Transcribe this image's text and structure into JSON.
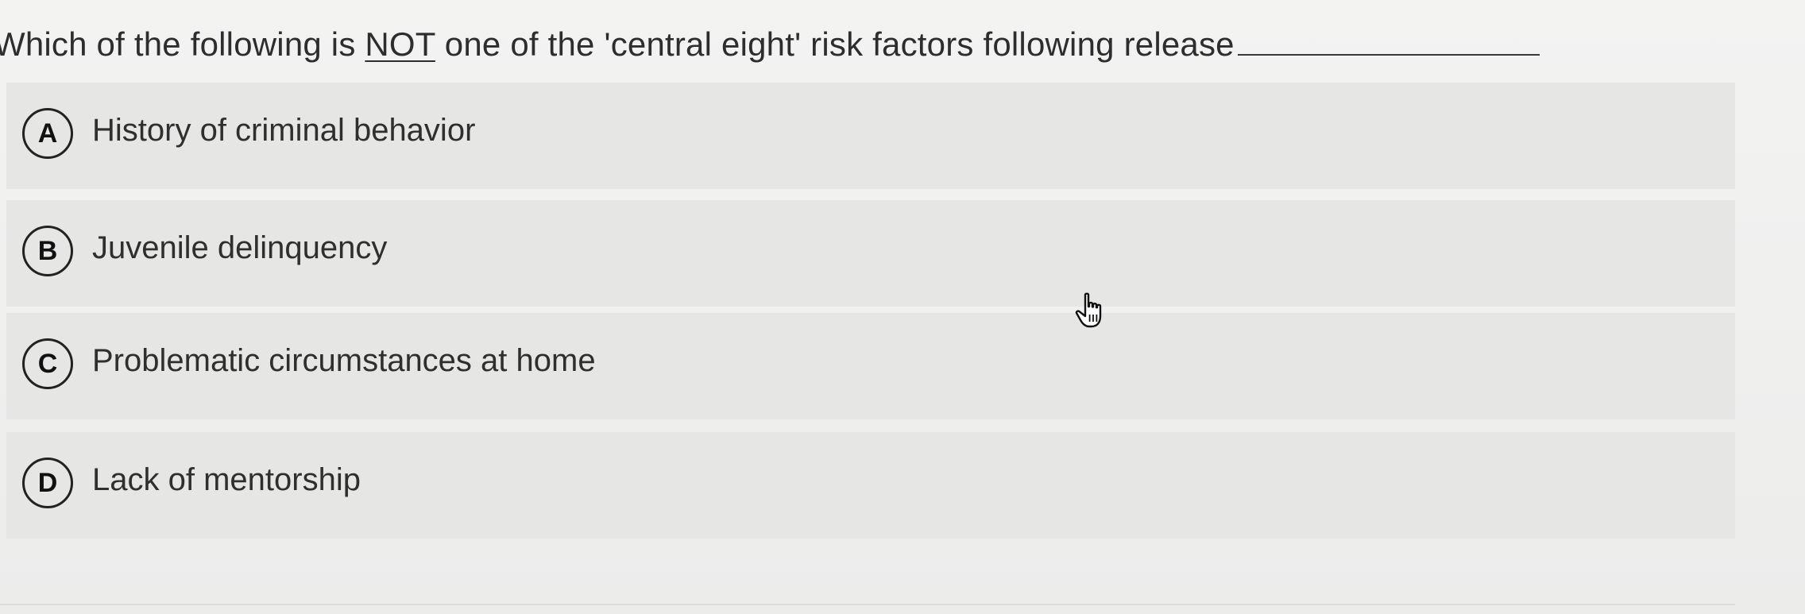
{
  "question": {
    "text_before": "Which of the following is ",
    "emphasis": "NOT",
    "text_after": " one of the 'central eight' risk factors following release"
  },
  "options": [
    {
      "letter": "A",
      "label": "History of criminal behavior"
    },
    {
      "letter": "B",
      "label": "Juvenile delinquency"
    },
    {
      "letter": "C",
      "label": "Problematic circumstances at home"
    },
    {
      "letter": "D",
      "label": "Lack of mentorship"
    }
  ],
  "cursor_icon": "hand-pointer-icon"
}
